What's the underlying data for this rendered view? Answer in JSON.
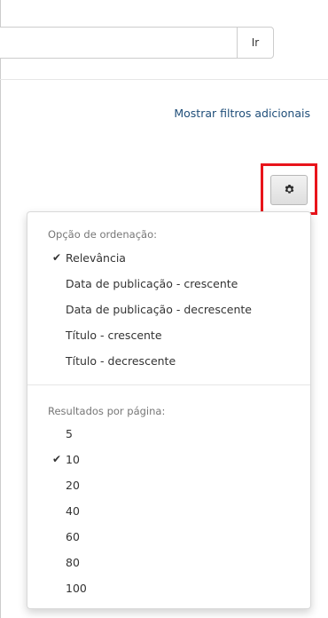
{
  "search": {
    "value": "",
    "placeholder": "",
    "go_label": "Ir"
  },
  "filters": {
    "link_label": "Mostrar filtros adicionais"
  },
  "settings": {
    "icon": "gear-icon",
    "highlight_color": "#e8141b"
  },
  "dropdown": {
    "sort_header": "Opção de ordenação:",
    "sort_options": [
      {
        "label": "Relevância",
        "selected": true
      },
      {
        "label": "Data de publicação - crescente",
        "selected": false
      },
      {
        "label": "Data de publicação - decrescente",
        "selected": false
      },
      {
        "label": "Título - crescente",
        "selected": false
      },
      {
        "label": "Título - decrescente",
        "selected": false
      }
    ],
    "rpp_header": "Resultados por página:",
    "rpp_options": [
      {
        "label": "5",
        "selected": false
      },
      {
        "label": "10",
        "selected": true
      },
      {
        "label": "20",
        "selected": false
      },
      {
        "label": "40",
        "selected": false
      },
      {
        "label": "60",
        "selected": false
      },
      {
        "label": "80",
        "selected": false
      },
      {
        "label": "100",
        "selected": false
      }
    ],
    "check_glyph": "✔"
  }
}
